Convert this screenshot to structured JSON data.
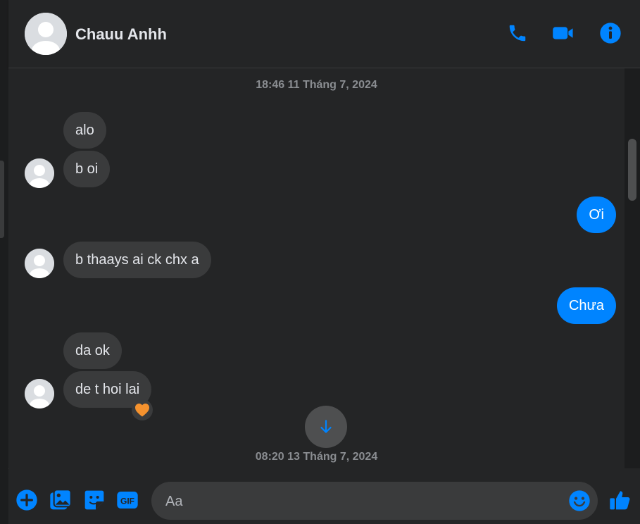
{
  "header": {
    "contact_name": "Chauu Anhh",
    "icons": [
      "phone-icon",
      "video-call-icon",
      "info-icon"
    ]
  },
  "messages": {
    "timestamp_1": "18:46 11 Tháng 7, 2024",
    "timestamp_2": "08:20 13 Tháng 7, 2024",
    "items": [
      {
        "from": "them",
        "text": "alo"
      },
      {
        "from": "them",
        "text": "b oi"
      },
      {
        "from": "me",
        "text": "Ơi"
      },
      {
        "from": "them",
        "text": "b thaays ai ck chx a"
      },
      {
        "from": "me",
        "text": "Chưa"
      },
      {
        "from": "them",
        "text": "da ok"
      },
      {
        "from": "them",
        "text": "de t hoi lai",
        "reaction": "orange-heart"
      }
    ]
  },
  "composer": {
    "placeholder": "Aa",
    "gif_label": "GIF",
    "icons": [
      "add-icon",
      "image-icon",
      "sticker-icon",
      "gif-icon",
      "emoji-icon",
      "like-icon"
    ]
  },
  "colors": {
    "accent": "#0084ff",
    "background": "#242526",
    "incoming_bubble": "#3a3b3c",
    "reaction_heart": "#f5922e"
  }
}
